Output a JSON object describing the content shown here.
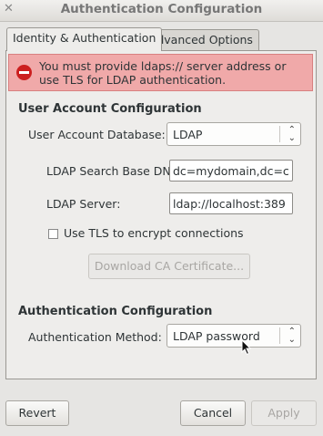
{
  "window": {
    "title": "Authentication Configuration"
  },
  "tabs": [
    {
      "label": "Identity & Authentication",
      "active": true
    },
    {
      "label": "Advanced Options",
      "active": false
    }
  ],
  "error": {
    "line1": "You must provide ldaps:// server address or",
    "line2": "use TLS for LDAP authentication."
  },
  "user_account": {
    "section_title": "User Account Configuration",
    "database_label": "User Account Database:",
    "database_value": "LDAP",
    "base_dn_label": "LDAP Search Base DN:",
    "base_dn_value": "dc=mydomain,dc=com",
    "server_label": "LDAP Server:",
    "server_value": "ldap://localhost:389",
    "tls_label": "Use TLS to encrypt connections",
    "tls_checked": false,
    "download_ca_label": "Download CA Certificate..."
  },
  "auth": {
    "section_title": "Authentication Configuration",
    "method_label": "Authentication Method:",
    "method_value": "LDAP password"
  },
  "footer": {
    "revert_label": "Revert",
    "cancel_label": "Cancel",
    "apply_label": "Apply"
  }
}
